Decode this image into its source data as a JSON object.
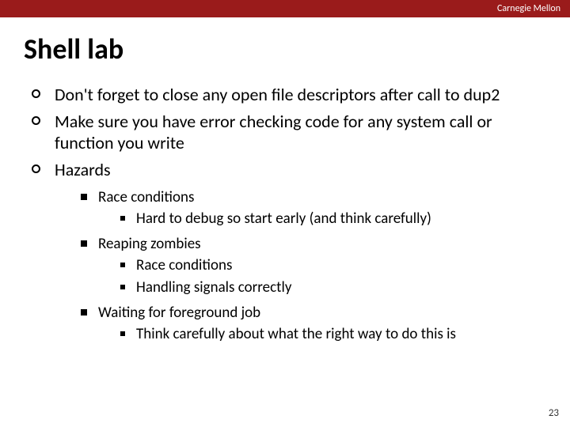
{
  "header": {
    "org": "Carnegie Mellon"
  },
  "title": "Shell lab",
  "bullets": [
    "Don't forget to close any open file descriptors after call to dup2",
    "Make sure you have error checking code for any system call or function you write",
    "Hazards"
  ],
  "hazards": [
    {
      "label": "Race conditions",
      "sub": [
        "Hard to debug so start early (and think carefully)"
      ]
    },
    {
      "label": "Reaping zombies",
      "sub": [
        "Race conditions",
        "Handling signals correctly"
      ]
    },
    {
      "label": "Waiting for foreground job",
      "sub": [
        "Think carefully about what the right way to do this is"
      ]
    }
  ],
  "page_number": "23"
}
